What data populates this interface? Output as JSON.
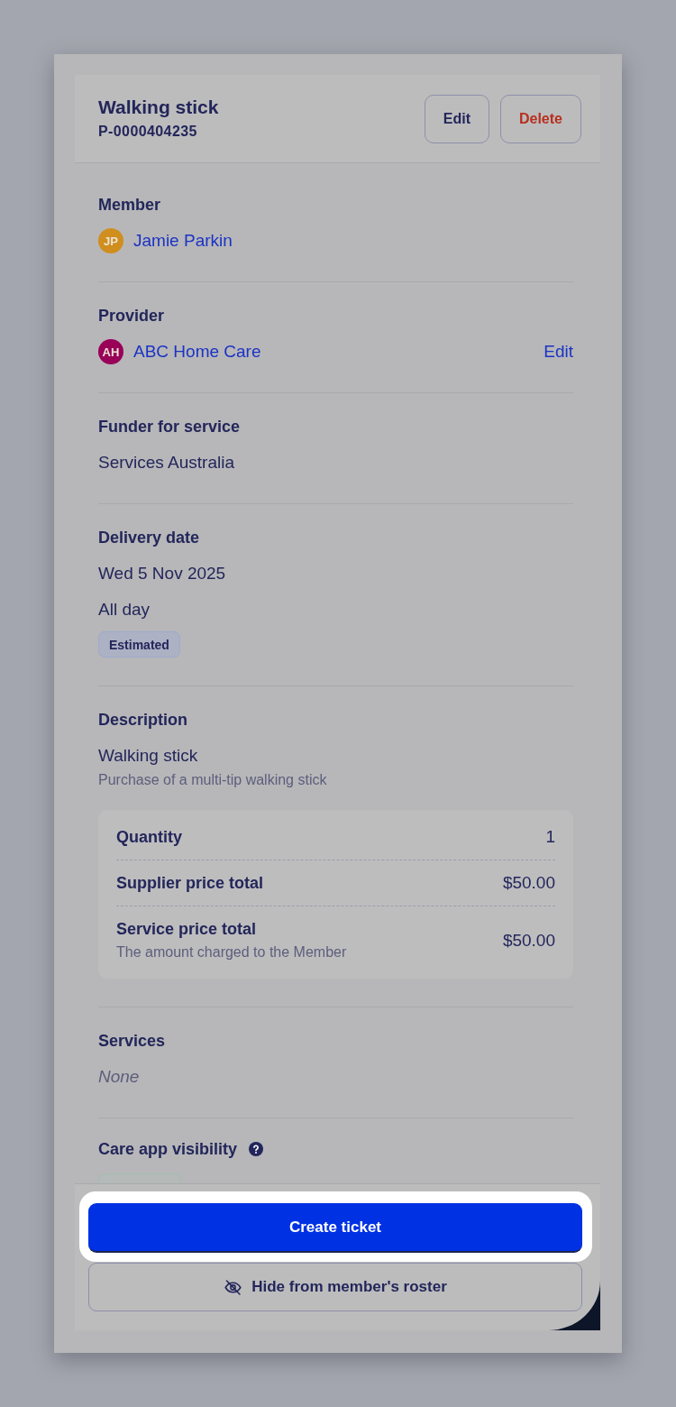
{
  "header": {
    "title": "Walking stick",
    "reference": "P-0000404235",
    "actions": [
      {
        "label": "Edit",
        "kind": "neutral"
      },
      {
        "label": "Delete",
        "kind": "danger"
      }
    ]
  },
  "sections": [
    {
      "kind": "person",
      "label": "Member",
      "initials": "JP",
      "color": "#d08e1e",
      "name": "Jamie Parkin"
    },
    {
      "kind": "person",
      "label": "Provider",
      "initials": "AH",
      "color": "#990058",
      "name": "ABC Home Care",
      "action": "Edit"
    },
    {
      "kind": "text",
      "label": "Funder for service",
      "lines": [
        "Services Australia"
      ]
    },
    {
      "kind": "text",
      "label": "Delivery date",
      "lines": [
        "Wed 5 Nov 2025",
        "All day"
      ],
      "badge": "Estimated"
    },
    {
      "kind": "description",
      "label": "Description",
      "title": "Walking stick",
      "subtitle": "Purchase of a multi-tip walking stick",
      "rows": [
        {
          "label": "Quantity",
          "value": "1"
        },
        {
          "label": "Supplier price total",
          "value": "$50.00"
        },
        {
          "label": "Service price total",
          "note": "The amount charged to the Member",
          "value": "$50.00"
        }
      ]
    },
    {
      "kind": "empty",
      "label": "Services",
      "value": "None"
    },
    {
      "kind": "visibility",
      "label": "Care app visibility",
      "help": true
    }
  ],
  "footer": {
    "buttons": [
      {
        "label": "Create ticket",
        "kind": "primary",
        "highlighted": true
      },
      {
        "label": "Hide from member's roster",
        "kind": "hide",
        "highlighted": false
      }
    ]
  }
}
